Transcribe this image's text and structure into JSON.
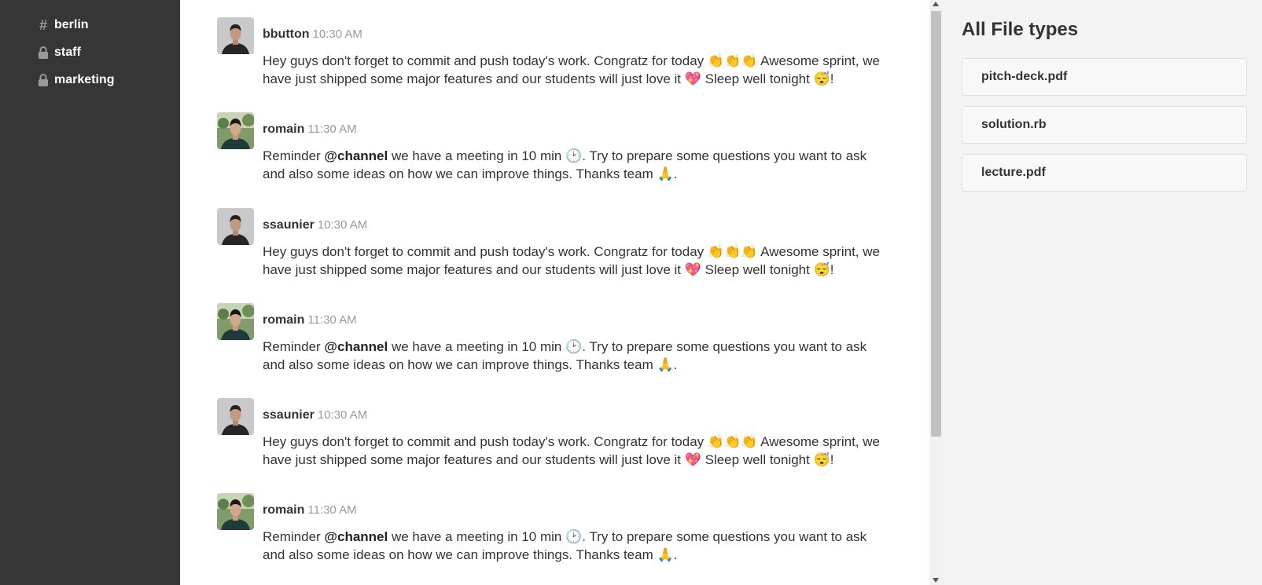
{
  "sidebar": {
    "channels": [
      {
        "name": "berlin",
        "icon": "hash-icon"
      },
      {
        "name": "staff",
        "icon": "lock-icon"
      },
      {
        "name": "marketing",
        "icon": "lock-icon"
      }
    ]
  },
  "messages": [
    {
      "author": "bbutton",
      "time": "10:30 AM",
      "avatar": "dark-avatar",
      "text_a": "Hey guys don't forget to commit and push today's work. Congratz for today 👏👏👏 Awesome sprint, we have just shipped some major features and our students will just love it 💖 Sleep well tonight 😴!"
    },
    {
      "author": "romain",
      "time": "11:30 AM",
      "avatar": "green-avatar",
      "text_a": "Reminder ",
      "mention": "@channel",
      "text_b": " we have a meeting in 10 min 🕑. Try to prepare some questions you want to ask and also some ideas on how we can improve things. Thanks team 🙏."
    },
    {
      "author": "ssaunier",
      "time": "10:30 AM",
      "avatar": "dark-avatar",
      "text_a": "Hey guys don't forget to commit and push today's work. Congratz for today 👏👏👏 Awesome sprint, we have just shipped some major features and our students will just love it 💖 Sleep well tonight 😴!"
    },
    {
      "author": "romain",
      "time": "11:30 AM",
      "avatar": "green-avatar",
      "text_a": "Reminder ",
      "mention": "@channel",
      "text_b": " we have a meeting in 10 min 🕑. Try to prepare some questions you want to ask and also some ideas on how we can improve things. Thanks team 🙏."
    },
    {
      "author": "ssaunier",
      "time": "10:30 AM",
      "avatar": "dark-avatar",
      "text_a": "Hey guys don't forget to commit and push today's work. Congratz for today 👏👏👏 Awesome sprint, we have just shipped some major features and our students will just love it 💖 Sleep well tonight 😴!"
    },
    {
      "author": "romain",
      "time": "11:30 AM",
      "avatar": "green-avatar",
      "text_a": "Reminder ",
      "mention": "@channel",
      "text_b": " we have a meeting in 10 min 🕑. Try to prepare some questions you want to ask and also some ideas on how we can improve things. Thanks team 🙏."
    }
  ],
  "files_panel": {
    "title": "All File types",
    "files": [
      "pitch-deck.pdf",
      "solution.rb",
      "lecture.pdf"
    ]
  },
  "colors": {
    "sidebar_bg": "#363636",
    "panel_bg": "#f3f3f3",
    "timestamp": "#999999"
  }
}
